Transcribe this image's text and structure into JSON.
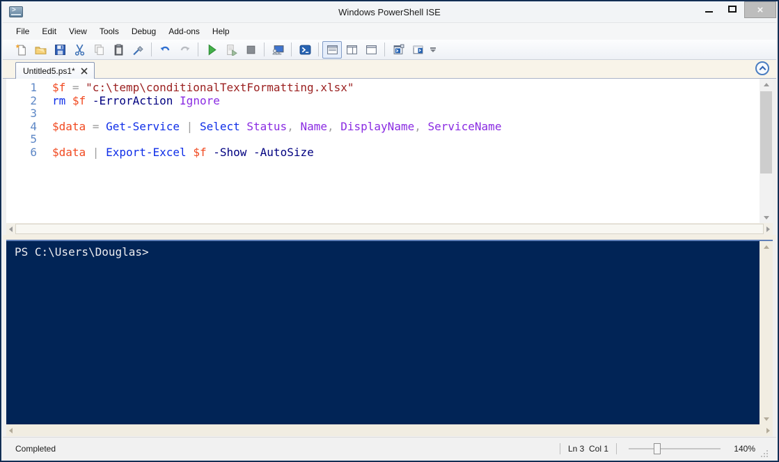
{
  "window": {
    "title": "Windows PowerShell ISE"
  },
  "menu": {
    "items": [
      "File",
      "Edit",
      "View",
      "Tools",
      "Debug",
      "Add-ons",
      "Help"
    ]
  },
  "toolbar": {
    "icons": [
      "new-script",
      "open-script",
      "save-script",
      "cut",
      "copy",
      "paste",
      "clear-console-pane",
      "undo",
      "redo",
      "run-script",
      "run-selection",
      "stop-operation",
      "new-remote-powershell-tab",
      "start-powershell",
      "show-script-pane-top",
      "show-script-pane-right",
      "show-script-pane-maximized",
      "new-powershell-tab",
      "close-powershell-tab",
      "toolbar-overflow"
    ],
    "selected_icon": "show-script-pane-top"
  },
  "tabs": {
    "active": {
      "label": "Untitled5.ps1*"
    }
  },
  "editor": {
    "lines": [
      {
        "number": "1",
        "tokens": [
          {
            "t": "var",
            "v": "$f"
          },
          {
            "t": "op",
            "v": " = "
          },
          {
            "t": "str",
            "v": "\"c:\\temp\\conditionalTextFormatting.xlsx\""
          }
        ]
      },
      {
        "number": "2",
        "tokens": [
          {
            "t": "cmd",
            "v": "rm"
          },
          {
            "t": "plain",
            "v": " "
          },
          {
            "t": "var",
            "v": "$f"
          },
          {
            "t": "plain",
            "v": " "
          },
          {
            "t": "param",
            "v": "-ErrorAction"
          },
          {
            "t": "plain",
            "v": " "
          },
          {
            "t": "arg",
            "v": "Ignore"
          }
        ]
      },
      {
        "number": "3",
        "tokens": []
      },
      {
        "number": "4",
        "tokens": [
          {
            "t": "var",
            "v": "$data"
          },
          {
            "t": "op",
            "v": " = "
          },
          {
            "t": "cmd",
            "v": "Get-Service"
          },
          {
            "t": "op",
            "v": " | "
          },
          {
            "t": "cmd",
            "v": "Select"
          },
          {
            "t": "plain",
            "v": " "
          },
          {
            "t": "arg",
            "v": "Status"
          },
          {
            "t": "op",
            "v": ", "
          },
          {
            "t": "arg",
            "v": "Name"
          },
          {
            "t": "op",
            "v": ", "
          },
          {
            "t": "arg",
            "v": "DisplayName"
          },
          {
            "t": "op",
            "v": ", "
          },
          {
            "t": "arg",
            "v": "ServiceName"
          }
        ]
      },
      {
        "number": "5",
        "tokens": []
      },
      {
        "number": "6",
        "tokens": [
          {
            "t": "var",
            "v": "$data"
          },
          {
            "t": "op",
            "v": " | "
          },
          {
            "t": "cmd",
            "v": "Export-Excel"
          },
          {
            "t": "plain",
            "v": " "
          },
          {
            "t": "var",
            "v": "$f"
          },
          {
            "t": "plain",
            "v": " "
          },
          {
            "t": "param",
            "v": "-Show"
          },
          {
            "t": "plain",
            "v": " "
          },
          {
            "t": "param",
            "v": "-AutoSize"
          }
        ]
      }
    ]
  },
  "console": {
    "prompt": "PS C:\\Users\\Douglas>"
  },
  "statusbar": {
    "status": "Completed",
    "line_col": "Ln 3  Col 1",
    "zoom_label": "140%",
    "zoom_percent": 140
  },
  "colors": {
    "console-bg": "#012456",
    "console-text": "#eeedf0",
    "syntax-line-number": "#5d87c6",
    "syntax-variable": "#f14a21",
    "syntax-operator": "#9d9d9d",
    "syntax-string": "#9b2121",
    "syntax-command": "#0f2ee8",
    "syntax-parameter": "#000080",
    "syntax-argument": "#8a2be2"
  }
}
